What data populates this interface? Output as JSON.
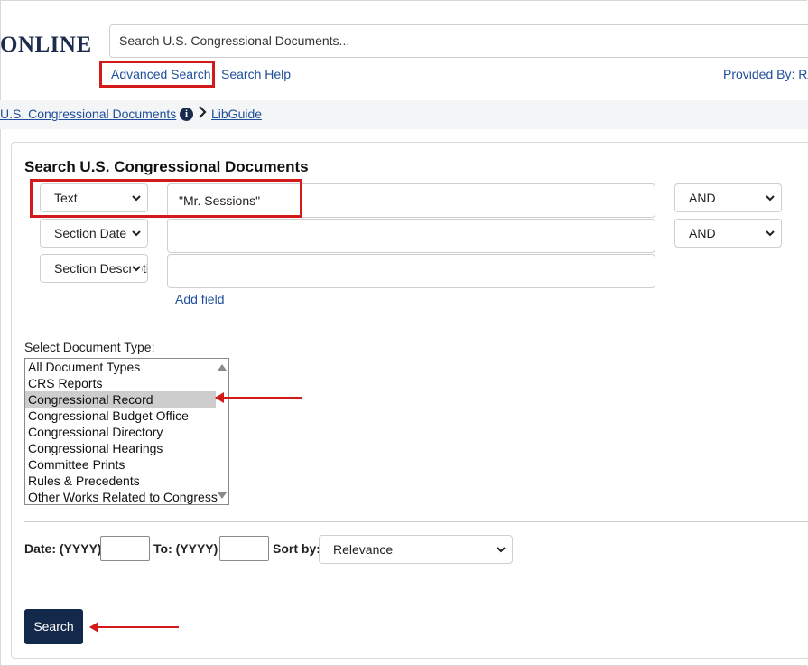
{
  "header": {
    "logo_text": "ONLINE",
    "search_placeholder": "Search U.S. Congressional Documents...",
    "advanced_search": "Advanced Search",
    "search_help": "Search Help",
    "provided_by": "Provided By: RA"
  },
  "breadcrumb": {
    "item1": "U.S. Congressional Documents",
    "item2": "LibGuide"
  },
  "form": {
    "title": "Search U.S. Congressional Documents",
    "rows": [
      {
        "field": "Text",
        "value": "\"Mr. Sessions\"",
        "op": "AND"
      },
      {
        "field": "Section Date",
        "value": "",
        "op": "AND"
      },
      {
        "field": "Section Description",
        "value": ""
      }
    ],
    "add_field": "Add field",
    "doc_type_label": "Select Document Type:",
    "doc_types": [
      "All Document Types",
      "CRS Reports",
      "Congressional Record",
      "Congressional Budget Office",
      "Congressional Directory",
      "Congressional Hearings",
      "Committee Prints",
      "Rules & Precedents",
      "Other Works Related to Congress"
    ],
    "selected_doc_type": "Congressional Record",
    "date_from_label": "Date: (YYYY)",
    "date_to_label": "To: (YYYY)",
    "sort_label": "Sort by:",
    "sort_value": "Relevance",
    "submit": "Search"
  },
  "colors": {
    "brand": "#13294b",
    "link": "#1f4e9a",
    "highlight": "#d21a1a"
  }
}
